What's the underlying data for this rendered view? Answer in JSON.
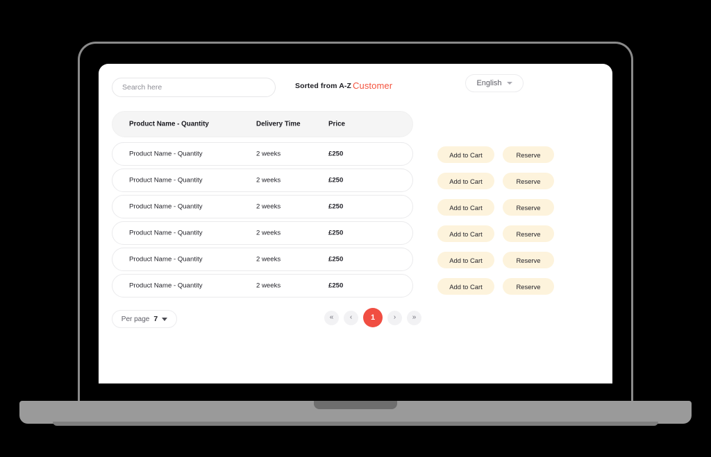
{
  "device": {
    "type": "laptop-mockup"
  },
  "colors": {
    "accent_red": "#f04e42",
    "customer_text": "#f4533e",
    "button_cream": "#fdf3dc",
    "header_row_bg": "#f5f5f5",
    "pagination_bg": "#f2f2f4",
    "frame_gray": "#8a8a8a",
    "base_gray": "#9a9a9a"
  },
  "topbar": {
    "search": {
      "placeholder": "Search here",
      "value": ""
    },
    "sorted_label": "Sorted from A-Z",
    "customer_label": "Customer",
    "language": {
      "selected": "English",
      "caret_icon": "chevron-down-icon"
    }
  },
  "table": {
    "columns": [
      "Product Name - Quantity",
      "Delivery Time",
      "Price"
    ],
    "rows": [
      {
        "name": "Product Name - Quantity",
        "delivery": "2 weeks",
        "price": "£250",
        "add_to_cart": "Add to Cart",
        "reserve": "Reserve"
      },
      {
        "name": "Product Name - Quantity",
        "delivery": "2 weeks",
        "price": "£250",
        "add_to_cart": "Add to Cart",
        "reserve": "Reserve"
      },
      {
        "name": "Product Name - Quantity",
        "delivery": "2 weeks",
        "price": "£250",
        "add_to_cart": "Add to Cart",
        "reserve": "Reserve"
      },
      {
        "name": "Product Name - Quantity",
        "delivery": "2 weeks",
        "price": "£250",
        "add_to_cart": "Add to Cart",
        "reserve": "Reserve"
      },
      {
        "name": "Product Name - Quantity",
        "delivery": "2 weeks",
        "price": "£250",
        "add_to_cart": "Add to Cart",
        "reserve": "Reserve"
      },
      {
        "name": "Product Name - Quantity",
        "delivery": "2 weeks",
        "price": "£250",
        "add_to_cart": "Add to Cart",
        "reserve": "Reserve"
      }
    ]
  },
  "footer": {
    "per_page": {
      "label": "Per page",
      "value": "7",
      "caret_icon": "caret-down-icon"
    },
    "pagination": {
      "first": "«",
      "prev": "‹",
      "current": "1",
      "next": "›",
      "last": "»"
    }
  }
}
